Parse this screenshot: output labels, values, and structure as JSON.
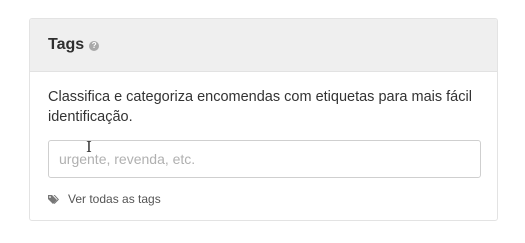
{
  "card": {
    "title": "Tags",
    "help_icon": "question-circle-icon",
    "description": "Classifica e categoriza encomendas com etiquetas para mais fácil identificação.",
    "input": {
      "placeholder": "urgente, revenda, etc.",
      "value": ""
    },
    "view_all_link": {
      "icon": "tags-icon",
      "label": "Ver todas as tags"
    }
  }
}
